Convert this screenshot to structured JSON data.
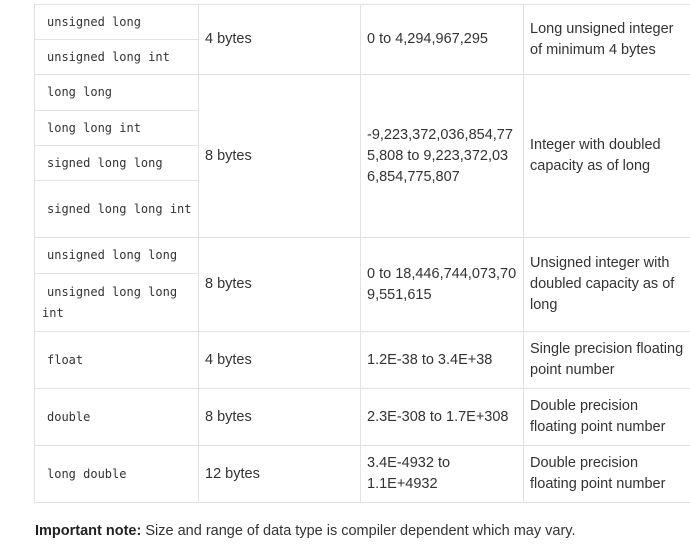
{
  "rows": [
    {
      "types": [
        "unsigned long",
        "unsigned long int"
      ],
      "size": "4 bytes",
      "range": "0 to 4,294,967,295",
      "desc": "Long unsigned integer of minimum 4 bytes"
    },
    {
      "types": [
        "long long",
        "long long int",
        "signed long long",
        "signed long long int"
      ],
      "size": "8 bytes",
      "range": "-9,223,372,036,854,775,808 to 9,223,372,036,854,775,807",
      "desc": "Integer with doubled capacity as of long"
    },
    {
      "types": [
        "unsigned long long",
        "unsigned long long int"
      ],
      "size": "8 bytes",
      "range": "0 to 18,446,744,073,709,551,615",
      "desc": "Unsigned integer with doubled capacity as of long"
    },
    {
      "types": [
        "float"
      ],
      "size": "4 bytes",
      "range": "1.2E-38 to 3.4E+38",
      "desc": "Single precision floating point number"
    },
    {
      "types": [
        "double"
      ],
      "size": "8 bytes",
      "range": "2.3E-308 to 1.7E+308",
      "desc": "Double precision floating point number"
    },
    {
      "types": [
        "long double"
      ],
      "size": "12 bytes",
      "range": "3.4E-4932 to 1.1E+4932",
      "desc": "Double precision floating point number"
    }
  ],
  "note": {
    "label": "Important note:",
    "text": " Size and range of data type is compiler dependent which may vary."
  }
}
